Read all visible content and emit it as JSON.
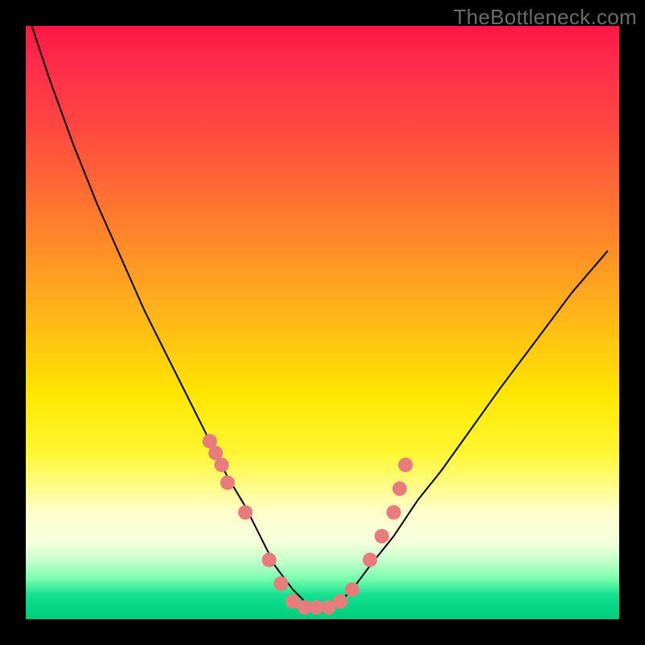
{
  "watermark": "TheBottleneck.com",
  "chart_data": {
    "type": "line",
    "title": "",
    "xlabel": "",
    "ylabel": "",
    "xlim": [
      0,
      100
    ],
    "ylim": [
      0,
      100
    ],
    "background": "vertical-gradient red→yellow→green",
    "series": [
      {
        "name": "curve",
        "x": [
          1,
          4,
          8,
          12,
          16,
          20,
          24,
          28,
          31,
          34,
          37,
          40,
          42,
          45,
          48,
          52,
          55,
          58,
          62,
          66,
          70,
          75,
          80,
          86,
          92,
          98
        ],
        "y": [
          100,
          91,
          80,
          70,
          61,
          52,
          44,
          36,
          30,
          24,
          19,
          13,
          9,
          5,
          2,
          2,
          5,
          9,
          14,
          20,
          25,
          32,
          39,
          47,
          55,
          62
        ],
        "stroke": "#000000",
        "stroke_width": 2
      },
      {
        "name": "dots",
        "type": "scatter",
        "x": [
          31,
          32,
          33,
          34,
          37,
          41,
          43,
          45,
          47,
          49,
          51,
          53,
          55,
          58,
          60,
          62,
          63,
          64
        ],
        "y": [
          30,
          28,
          26,
          23,
          18,
          10,
          6,
          3,
          2,
          2,
          2,
          3,
          5,
          10,
          14,
          18,
          22,
          26
        ],
        "color": "#e87c7c",
        "radius": 9
      }
    ]
  }
}
